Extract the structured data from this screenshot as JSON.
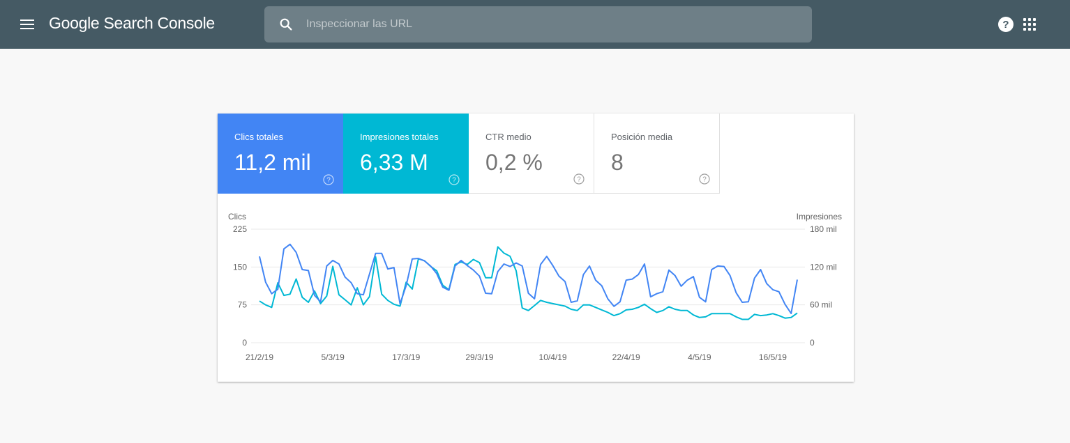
{
  "header": {
    "app_title": "Google Search Console",
    "search_placeholder": "Inspeccionar las URL",
    "icons": [
      "menu-icon",
      "search-icon",
      "help-icon",
      "apps-icon"
    ]
  },
  "metrics": [
    {
      "label": "Clics totales",
      "value": "11,2 mil",
      "color": "#4285f4",
      "selected": true
    },
    {
      "label": "Impresiones totales",
      "value": "6,33 M",
      "color": "#00b8d4",
      "selected": true
    },
    {
      "label": "CTR medio",
      "value": "0,2 %",
      "selected": false
    },
    {
      "label": "Posición media",
      "value": "8",
      "selected": false
    }
  ],
  "chart_data": {
    "type": "line",
    "title": "",
    "left_axis_label": "Clics",
    "right_axis_label": "Impresiones",
    "left_ticks": [
      "0",
      "75",
      "150",
      "225"
    ],
    "right_ticks": [
      "0",
      "60 mil",
      "120 mil",
      "180 mil"
    ],
    "left_ylim": [
      0,
      225
    ],
    "right_ylim": [
      0,
      180000
    ],
    "x_tick_labels": [
      "21/2/19",
      "5/3/19",
      "17/3/19",
      "29/3/19",
      "10/4/19",
      "22/4/19",
      "4/5/19",
      "16/5/19"
    ],
    "x_tick_day_index": [
      0,
      12,
      24,
      36,
      48,
      60,
      72,
      84
    ],
    "x_start": "21/2/19",
    "x_end": "20/5/19",
    "grid": true,
    "series": [
      {
        "name": "Clics",
        "axis": "left",
        "color": "#4285f4",
        "values": [
          171,
          120,
          97,
          106,
          186,
          195,
          179,
          145,
          143,
          94,
          81,
          152,
          163,
          156,
          130,
          119,
          97,
          95,
          136,
          177,
          177,
          146,
          149,
          77,
          113,
          166,
          167,
          162,
          152,
          137,
          110,
          104,
          152,
          163,
          153,
          144,
          132,
          98,
          97,
          141,
          156,
          151,
          158,
          152,
          98,
          87,
          155,
          171,
          153,
          132,
          121,
          80,
          83,
          135,
          152,
          124,
          113,
          87,
          72,
          81,
          124,
          126,
          135,
          156,
          91,
          97,
          101,
          144,
          133,
          112,
          124,
          131,
          90,
          81,
          145,
          152,
          151,
          133,
          99,
          80,
          81,
          128,
          145,
          117,
          105,
          101,
          76,
          58,
          125
        ]
      },
      {
        "name": "Impresiones",
        "axis": "right",
        "color": "#00b8d4",
        "values": [
          66000,
          60000,
          56000,
          95000,
          75000,
          77000,
          101000,
          72000,
          64000,
          82000,
          62000,
          74000,
          121000,
          76000,
          68000,
          60000,
          87000,
          60000,
          73000,
          136000,
          77000,
          67000,
          61000,
          58000,
          96000,
          85000,
          133000,
          130000,
          121000,
          114000,
          91000,
          84000,
          124000,
          128000,
          124000,
          132000,
          127000,
          103000,
          103000,
          152000,
          142000,
          137000,
          114000,
          55000,
          51000,
          59000,
          67000,
          64000,
          62000,
          60000,
          58000,
          53000,
          51000,
          60000,
          60000,
          56000,
          52000,
          48000,
          43000,
          46000,
          52000,
          53000,
          56000,
          61000,
          54000,
          48000,
          51000,
          57000,
          53000,
          51000,
          51000,
          44000,
          40000,
          41000,
          46000,
          46000,
          46000,
          46000,
          41000,
          37000,
          37000,
          45000,
          43000,
          44000,
          46000,
          43000,
          39000,
          40000,
          47000
        ]
      }
    ]
  }
}
